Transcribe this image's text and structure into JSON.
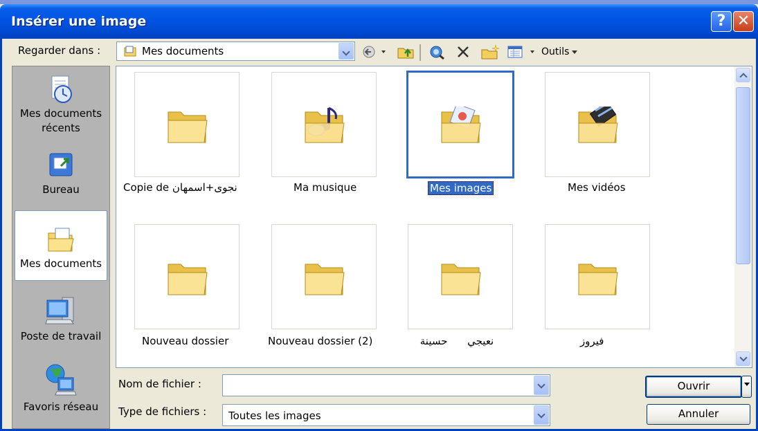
{
  "window": {
    "title": "Insérer une image",
    "help_label": "?",
    "close_label": "✕"
  },
  "lookin": {
    "label": "Regarder dans :",
    "value": "Mes documents"
  },
  "toolbar": {
    "tools_label": "Outils",
    "icons": [
      "back-icon",
      "up-folder-icon",
      "search-web-icon",
      "delete-icon",
      "new-folder-icon",
      "views-icon"
    ]
  },
  "places": [
    {
      "label": "Mes documents récents",
      "icon": "recent-documents-icon"
    },
    {
      "label": "Bureau",
      "icon": "desktop-icon"
    },
    {
      "label": "Mes documents",
      "icon": "my-documents-icon",
      "selected": true
    },
    {
      "label": "Poste de travail",
      "icon": "my-computer-icon"
    },
    {
      "label": "Favoris réseau",
      "icon": "network-places-icon"
    }
  ],
  "files": [
    {
      "name": "Copie de نجوى+اسمهان",
      "icon": "folder-icon"
    },
    {
      "name": "Ma musique",
      "icon": "music-folder-icon"
    },
    {
      "name": "Mes images",
      "icon": "pictures-folder-icon",
      "selected": true
    },
    {
      "name": "Mes vidéos",
      "icon": "videos-folder-icon"
    },
    {
      "name": "Nouveau dossier",
      "icon": "folder-icon"
    },
    {
      "name": "Nouveau dossier (2)",
      "icon": "folder-icon"
    },
    {
      "name": "نعيجي      حسينة",
      "icon": "folder-icon"
    },
    {
      "name": "فيروز",
      "icon": "folder-icon"
    }
  ],
  "filename": {
    "label": "Nom de fichier :",
    "value": ""
  },
  "filetype": {
    "label": "Type de fichiers :",
    "value": "Toutes les images"
  },
  "buttons": {
    "open": "Ouvrir",
    "cancel": "Annuler"
  },
  "colors": {
    "titlebar": "#0054e3",
    "selection": "#316ac5",
    "dialog": "#ece9d8"
  }
}
